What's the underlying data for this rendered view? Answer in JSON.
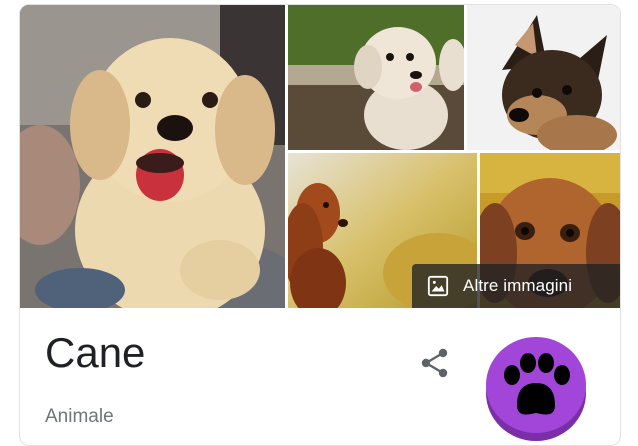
{
  "gallery": {
    "more_images_label": "Altre immagini",
    "more_images_icon": "image-icon"
  },
  "entity": {
    "title": "Cane",
    "subtitle": "Animale",
    "share_icon": "share-icon",
    "logo_icon": "paw-icon"
  },
  "colors": {
    "logo_purple": "#9b3fcf",
    "overlay": "#202124"
  }
}
